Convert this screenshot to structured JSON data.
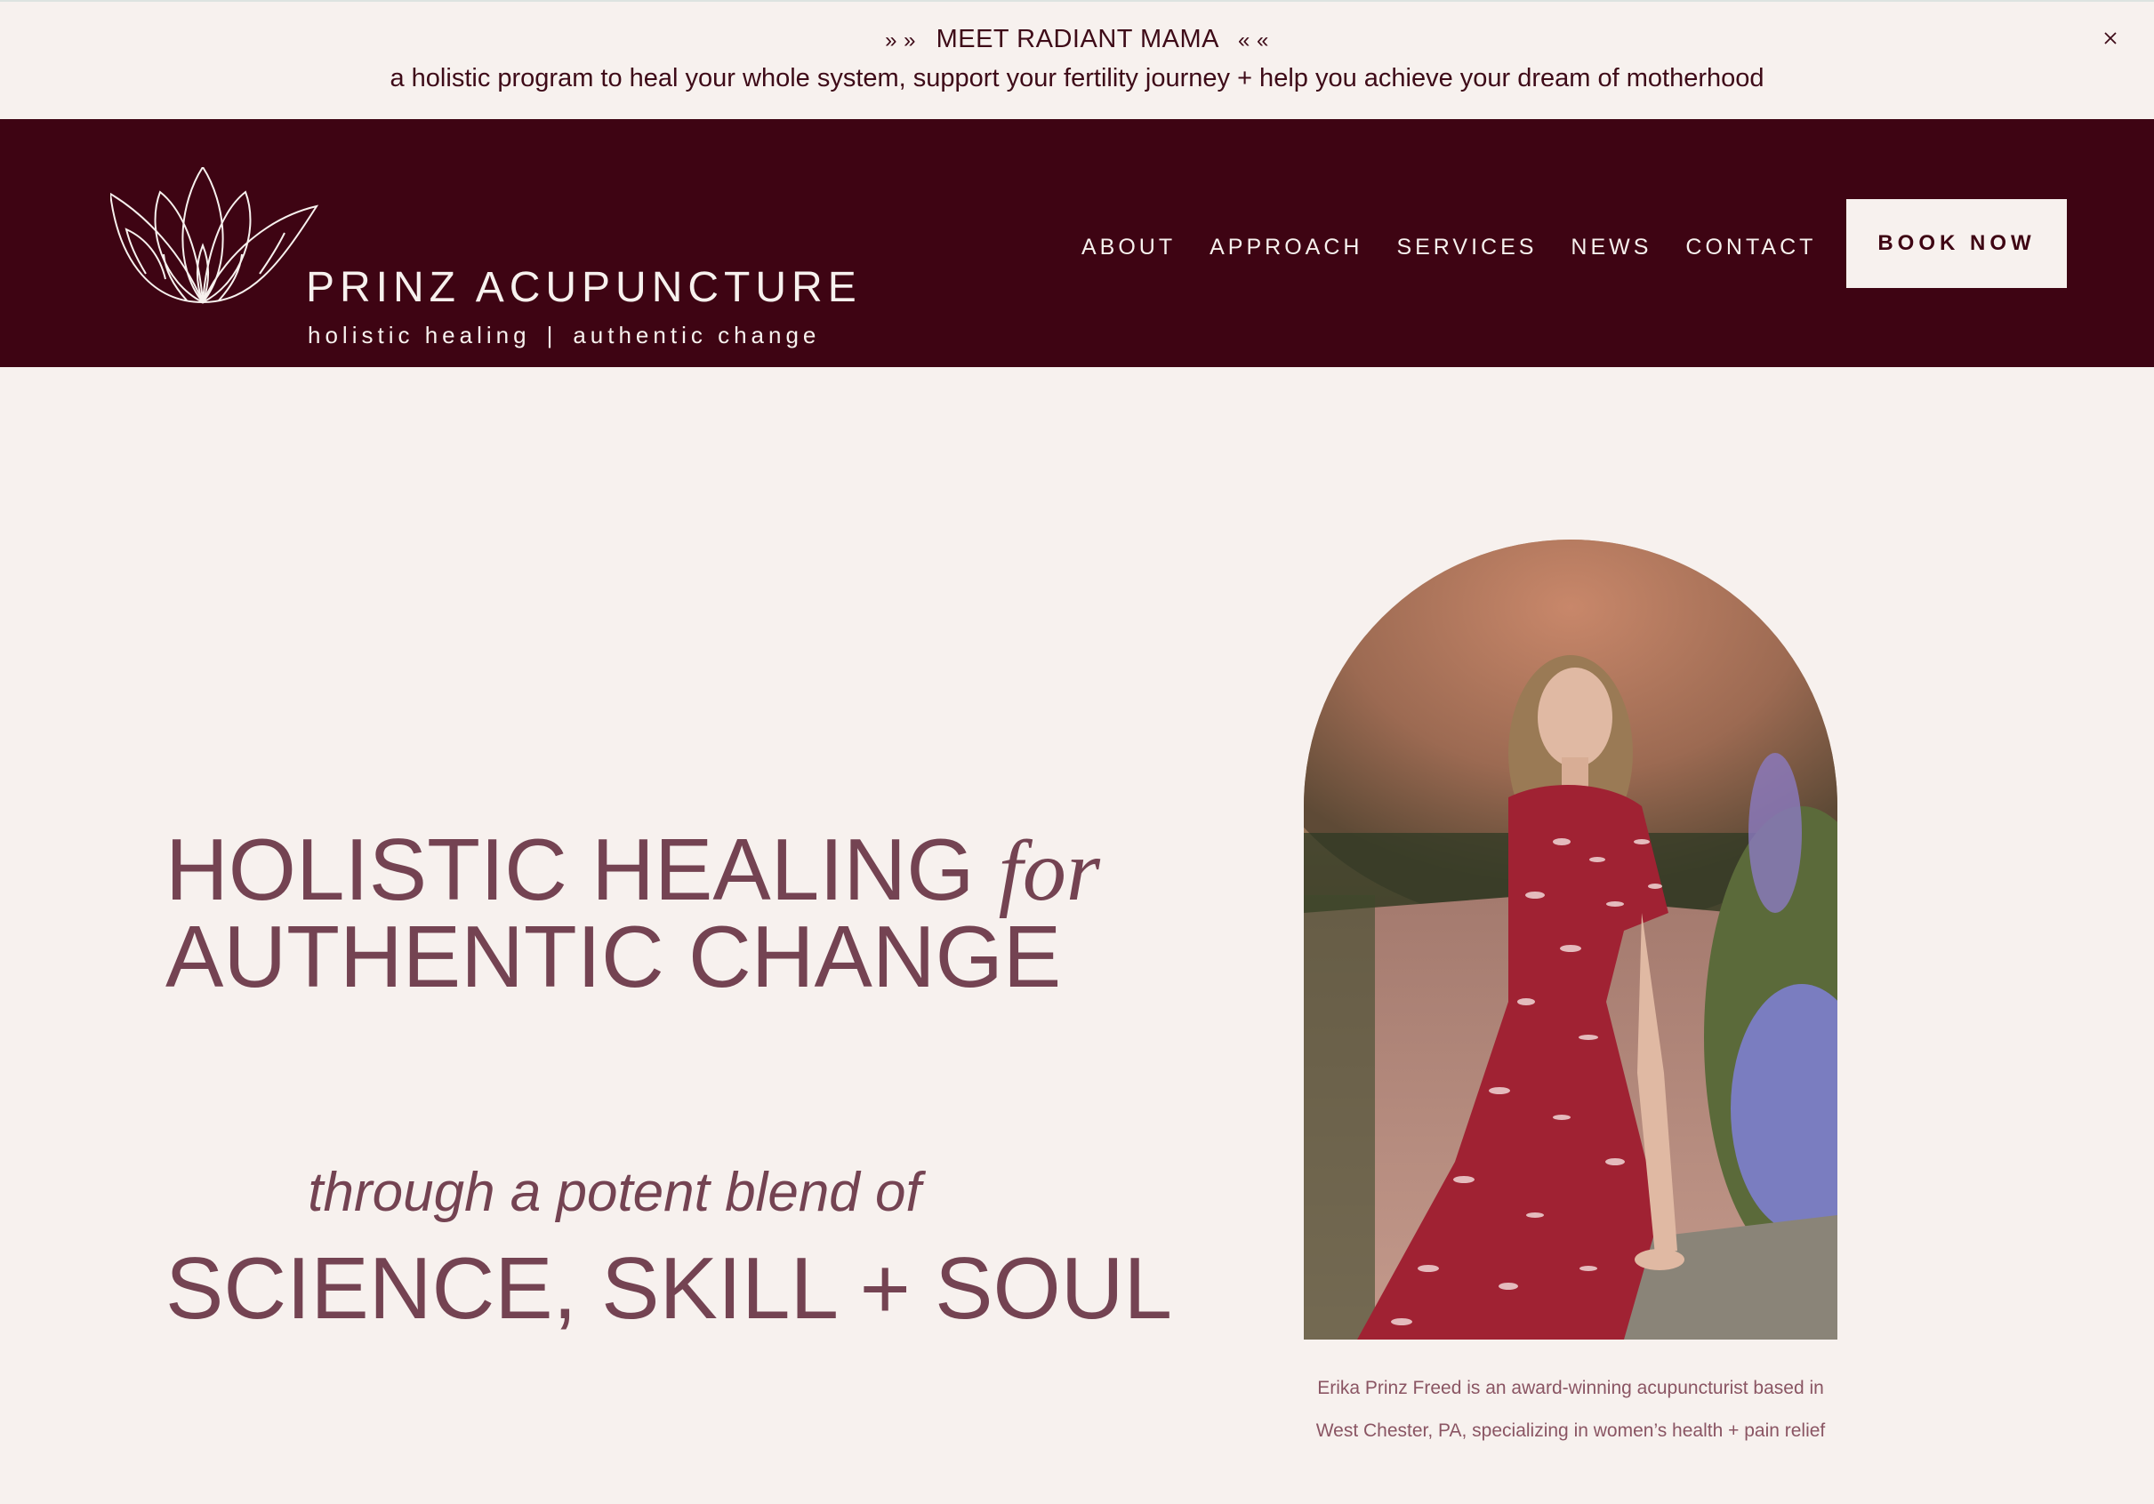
{
  "announcement": {
    "arrows_left": "» »",
    "title": "MEET RADIANT MAMA",
    "arrows_right": "« «",
    "subtitle": "a holistic program to heal your whole system, support your fertility journey + help you achieve your dream of motherhood",
    "close_icon": "close-icon"
  },
  "header": {
    "brand_name": "PRINZ ACUPUNCTURE",
    "brand_tag_left": "holistic healing",
    "brand_tag_sep": "|",
    "brand_tag_right": "authentic change",
    "logo_icon": "lotus-icon",
    "nav": [
      "ABOUT",
      "APPROACH",
      "SERVICES",
      "NEWS",
      "CONTACT"
    ],
    "cta": "BOOK NOW"
  },
  "hero": {
    "title_line1_main": "HOLISTIC HEALING",
    "title_line1_italic": "for",
    "title_line2": "AUTHENTIC CHANGE",
    "subtitle": "through a potent blend of",
    "tagline": "SCIENCE, SKILL + SOUL",
    "caption_line1": "Erika Prinz Freed is an award-winning acupuncturist based in",
    "caption_line2": "West Chester, PA, specializing in women’s health + pain relief"
  },
  "colors": {
    "background": "#f7f1ee",
    "header": "#3e0413",
    "accent_text": "#744352"
  }
}
